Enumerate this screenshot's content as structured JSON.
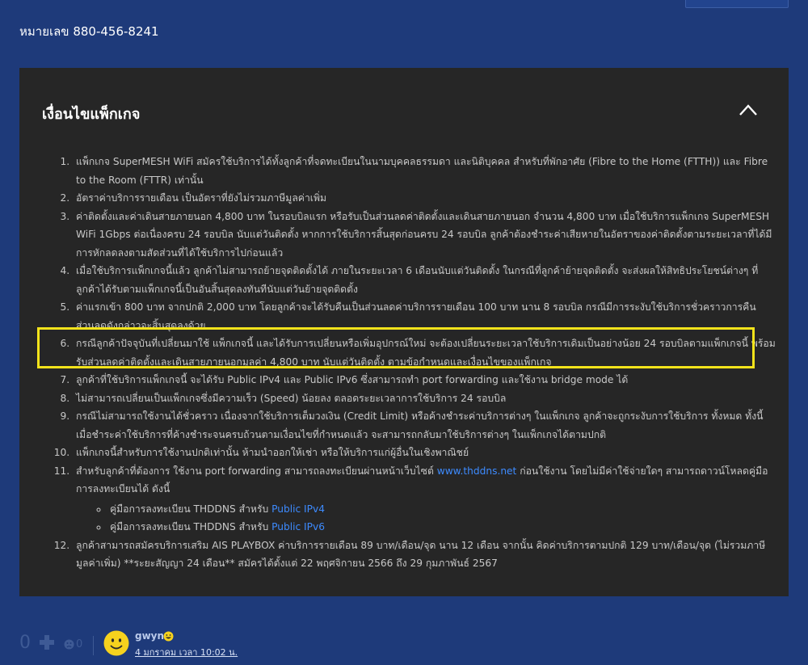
{
  "phone_line": "หมายเลข 880-456-8241",
  "section": {
    "title": "เงื่อนไขแพ็กเกจ"
  },
  "terms": [
    "แพ็กเกจ SuperMESH WiFi สมัครใช้บริการได้ทั้งลูกค้าที่จดทะเบียนในนามบุคคลธรรมดา และนิติบุคคล สำหรับที่พักอาศัย (Fibre to the Home (FTTH)) และ Fibre to the Room (FTTR) เท่านั้น",
    "อัตราค่าบริการรายเดือน เป็นอัตราที่ยังไม่รวมภาษีมูลค่าเพิ่ม",
    "ค่าติดตั้งและค่าเดินสายภายนอก 4,800 บาท ในรอบบิลแรก หรือรับเป็นส่วนลดค่าติดตั้งและเดินสายภายนอก จำนวน 4,800 บาท เมื่อใช้บริการแพ็กเกจ SuperMESH WiFi 1Gbps ต่อเนื่องครบ 24 รอบบิล นับแต่วันติดตั้ง หากการใช้บริการสิ้นสุดก่อนครบ 24 รอบบิล ลูกค้าต้องชำระค่าเสียหายในอัตราของค่าติดตั้งตามระยะเวลาที่ได้มีการหักลดลงตามสัดส่วนที่ได้ใช้บริการไปก่อนแล้ว",
    "เมื่อใช้บริการแพ็กเกจนี้แล้ว ลูกค้าไม่สามารถย้ายจุดติดตั้งได้ ภายในระยะเวลา 6 เดือนนับแต่วันติดตั้ง ในกรณีที่ลูกค้าย้ายจุดติดตั้ง จะส่งผลให้สิทธิประโยชน์ต่างๆ ที่ลูกค้าได้รับตามแพ็กเกจนี้เป็นอันสิ้นสุดลงทันทีนับแต่วันย้ายจุดติดตั้ง",
    "ค่าแรกเข้า 800 บาท จากปกติ 2,000 บาท โดยลูกค้าจะได้รับคืนเป็นส่วนลดค่าบริการรายเดือน 100 บาท นาน 8 รอบบิล กรณีมีการระงับใช้บริการชั่วคราวการคืนส่วนลดดังกล่าวจะสิ้นสุดลงด้วย",
    "กรณีลูกค้าปัจจุบันที่เปลี่ยนมาใช้ แพ็กเกจนี้ และได้รับการเปลี่ยนหรือเพิ่มอุปกรณ์ใหม่ จะต้องเปลี่ยนระยะเวลาใช้บริการเดิมเป็นอย่างน้อย 24 รอบบิลตามแพ็กเกจนี้ พร้อมรับส่วนลดค่าติดตั้งและเดินสายภายนอกมูลค่า 4,800 บาท นับแต่วันติดตั้ง ตามข้อกำหนดและเงื่อนไขของแพ็กเกจ",
    "ลูกค้าที่ใช้บริการแพ็กเกจนี้ จะได้รับ Public IPv4 และ Public IPv6 ซึ่งสามารถทำ port forwarding และใช้งาน bridge mode ได้",
    "ไม่สามารถเปลี่ยนเป็นแพ็กเกจซึ่งมีความเร็ว (Speed) น้อยลง ตลอดระยะเวลาการใช้บริการ 24 รอบบิล",
    "กรณีไม่สามารถใช้งานได้ชั่วคราว เนื่องจากใช้บริการเต็มวงเงิน (Credit Limit) หรือค้างชำระค่าบริการต่างๆ ในแพ็กเกจ ลูกค้าจะถูกระงับการใช้บริการ ทั้งหมด ทั้งนี้เมื่อชำระค่าใช้บริการที่ค้างชำระจนครบถ้วนตามเงื่อนไขที่กำหนดแล้ว จะสามารถกลับมาใช้บริการต่างๆ ในแพ็กเกจได้ตามปกติ",
    "แพ็กเกจนี้สำหรับการใช้งานปกติเท่านั้น ห้ามนำออกให้เช่า หรือให้บริการแก่ผู้อื่นในเชิงพาณิชย์"
  ],
  "term11": {
    "before_link": "สำหรับลูกค้าที่ต้องการ ใช้งาน port forwarding สามารถลงทะเบียนผ่านหน้าเว็บไซต์ ",
    "link_text": "www.thddns.net",
    "after_link": " ก่อนใช้งาน โดยไม่มีค่าใช้จ่ายใดๆ สามารถดาวน์โหลดคู่มือการลงทะเบียนได้ ดังนี้",
    "sub_items": [
      {
        "text": "คู่มือการลงทะเบียน THDDNS สำหรับ ",
        "link": "Public IPv4"
      },
      {
        "text": "คู่มือการลงทะเบียน THDDNS สำหรับ ",
        "link": "Public IPv6"
      }
    ]
  },
  "term12": "ลูกค้าสามารถสมัครบริการเสริม AIS PLAYBOX ค่าบริการรายเดือน 89 บาท/เดือน/จุด นาน 12 เดือน จากนั้น คิดค่าบริการตามปกติ 129 บาท/เดือน/จุด (ไม่รวมภาษีมูลค่าเพิ่ม) **ระยะสัญญา 24 เดือน** สมัครได้ตั้งแต่ 22 พฤศจิกายน 2566 ถึง 29 กุมภาพันธ์ 2567",
  "footer": {
    "vote_count": "0",
    "dislike_count": "0",
    "author": "gwyn",
    "date": "4 มกราคม เวลา 10:02 น."
  },
  "colors": {
    "page_bg": "#1e3a7a",
    "panel_bg": "#262626",
    "text_muted": "#c8c8c8",
    "link": "#3d8bff",
    "highlight": "#f3e31b"
  }
}
